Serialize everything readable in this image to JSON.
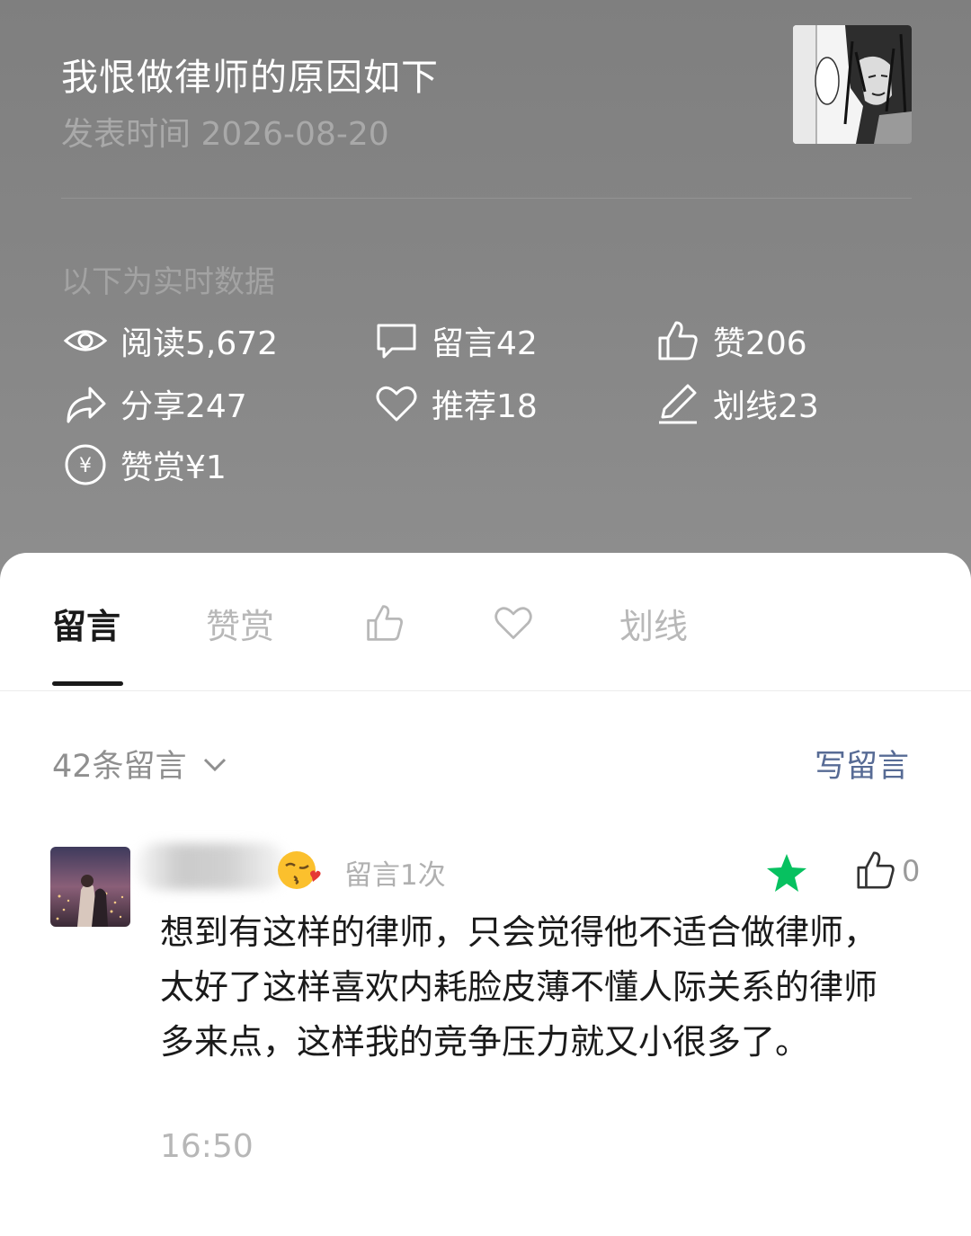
{
  "article": {
    "title": "我恨做律师的原因如下",
    "publish_time": "发表时间 2026-08-20"
  },
  "realtime_label": "以下为实时数据",
  "stats": {
    "reads": "阅读5,672",
    "comments": "留言42",
    "likes": "赞206",
    "shares": "分享247",
    "recommends": "推荐18",
    "underlines": "划线23",
    "rewards": "赞赏¥1"
  },
  "tabs": {
    "comments": "留言",
    "rewards": "赞赏",
    "likes_icon": "thumbs-up-icon",
    "recommend_icon": "heart-icon",
    "underlines": "划线"
  },
  "comment_section": {
    "count_label": "42条留言",
    "write_button": "写留言"
  },
  "comment": {
    "visit_count": "留言1次",
    "like_count": "0",
    "text": "想到有这样的律师，只会觉得他不适合做律师，太好了这样喜欢内耗脸皮薄不懂人际关系的律师多来点，这样我的竞争压力就又小很多了。",
    "time": "16:50",
    "starred": true
  },
  "colors": {
    "header_bg": "#858585",
    "link_blue": "#576b95",
    "star_green": "#07c160"
  }
}
